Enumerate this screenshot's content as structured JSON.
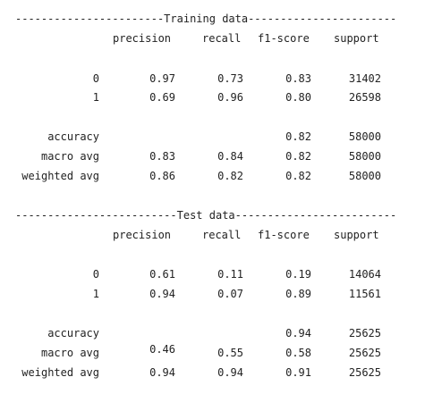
{
  "output": {
    "sections": [
      {
        "heading_line": "-----------------------Training data-----------------------",
        "columns": [
          "precision",
          "recall",
          "f1-score",
          "support"
        ],
        "rows": [
          {
            "label": "0",
            "precision": "0.97",
            "recall": "0.73",
            "f1": "0.83",
            "support": "31402"
          },
          {
            "label": "1",
            "precision": "0.69",
            "recall": "0.96",
            "f1": "0.80",
            "support": "26598"
          },
          {
            "label": "accuracy",
            "precision": "",
            "recall": "",
            "f1": "0.82",
            "support": "58000"
          },
          {
            "label": "macro avg",
            "precision": "0.83",
            "recall": "0.84",
            "f1": "0.82",
            "support": "58000"
          },
          {
            "label": "weighted avg",
            "precision": "0.86",
            "recall": "0.82",
            "f1": "0.82",
            "support": "58000"
          }
        ]
      },
      {
        "heading_line": "-------------------------Test data-------------------------",
        "columns": [
          "precision",
          "recall",
          "f1-score",
          "support"
        ],
        "rows": [
          {
            "label": "0",
            "precision": "0.61",
            "recall": "0.11",
            "f1": "0.19",
            "support": "14064"
          },
          {
            "label": "1",
            "precision": "0.94",
            "recall": "0.07",
            "f1": "0.89",
            "support": "11561"
          },
          {
            "label": "accuracy",
            "precision": "",
            "recall": "",
            "f1": "0.94",
            "support": "25625"
          },
          {
            "label": "macro avg",
            "precision": "0.46",
            "recall": "0.55",
            "f1": "0.58",
            "support": "25625"
          },
          {
            "label": "weighted avg",
            "precision": "0.94",
            "recall": "0.94",
            "f1": "0.91",
            "support": "25625"
          }
        ]
      }
    ]
  }
}
